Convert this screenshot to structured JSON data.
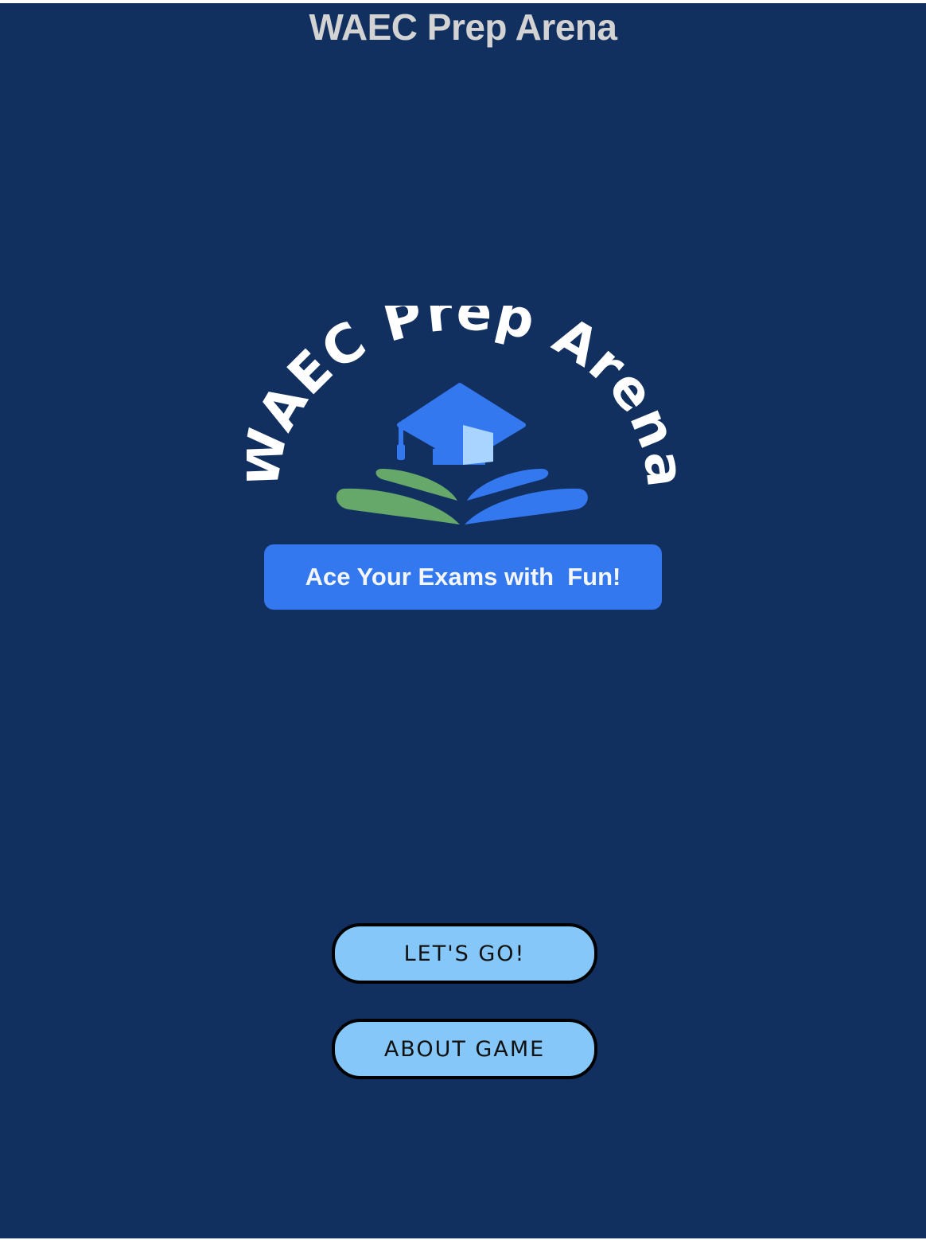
{
  "app_title": "WAEC Prep Arena",
  "logo": {
    "arc_text": "WAEC Prep Arena",
    "tagline": "Ace Your Exams with  Fun!"
  },
  "buttons": {
    "lets_go": "LET'S GO!",
    "about_game": "ABOUT GAME"
  },
  "colors": {
    "background": "#12305f",
    "title": "#d3d3d3",
    "accent_blue": "#3478f0",
    "cap_light": "#a9d4ff",
    "page_green": "#66a86a",
    "button_fill": "#85c7f8"
  }
}
